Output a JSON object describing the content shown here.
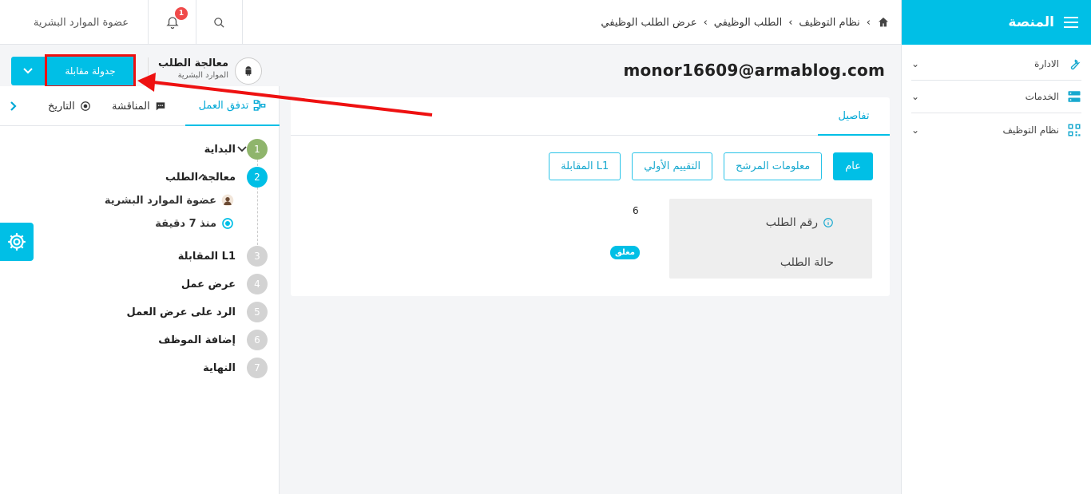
{
  "sidebar": {
    "brand": "المنصة",
    "items": [
      {
        "label": "الادارة",
        "icon": "wrench-icon"
      },
      {
        "label": "الخدمات",
        "icon": "server-icon"
      },
      {
        "label": "نظام التوظيف",
        "icon": "qr-icon"
      }
    ]
  },
  "topbar": {
    "user_name": "عضوة الموارد البشرية",
    "notification_count": "1",
    "breadcrumb": [
      "نظام التوظيف",
      "الطلب الوظيفي",
      "عرض الطلب الوظيفي"
    ]
  },
  "header": {
    "email": "monor16609@armablog.com",
    "process_title": "معالجة الطلب",
    "process_subtitle": "الموارد البشرية",
    "schedule_button": "جدولة مقابلة"
  },
  "left_panel": {
    "tabs": {
      "workflow": "تدفق العمل",
      "discussion": "المناقشة",
      "history": "التاريخ"
    },
    "steps": [
      {
        "num": "1",
        "label": "البداية"
      },
      {
        "num": "2",
        "label": "معالجة الطلب"
      },
      {
        "num": "3",
        "label": "المقابلة L1"
      },
      {
        "num": "4",
        "label": "عرض عمل"
      },
      {
        "num": "5",
        "label": "الرد على عرض العمل"
      },
      {
        "num": "6",
        "label": "إضافة الموظف"
      },
      {
        "num": "7",
        "label": "النهاية"
      }
    ],
    "assignee": "عضوة الموارد البشرية",
    "time_ago": "منذ 7 دقيقة"
  },
  "card": {
    "tab_details": "تفاصيل",
    "subtabs": [
      "عام",
      "معلومات المرشح",
      "التقييم الأولي",
      "المقابلة L1"
    ],
    "request_number_label": "رقم الطلب",
    "request_status_label": "حالة الطلب",
    "request_number_value": "6",
    "request_status_value": "مغلق"
  },
  "colors": {
    "accent": "#00bfe6",
    "annotation": "#ee1111"
  }
}
